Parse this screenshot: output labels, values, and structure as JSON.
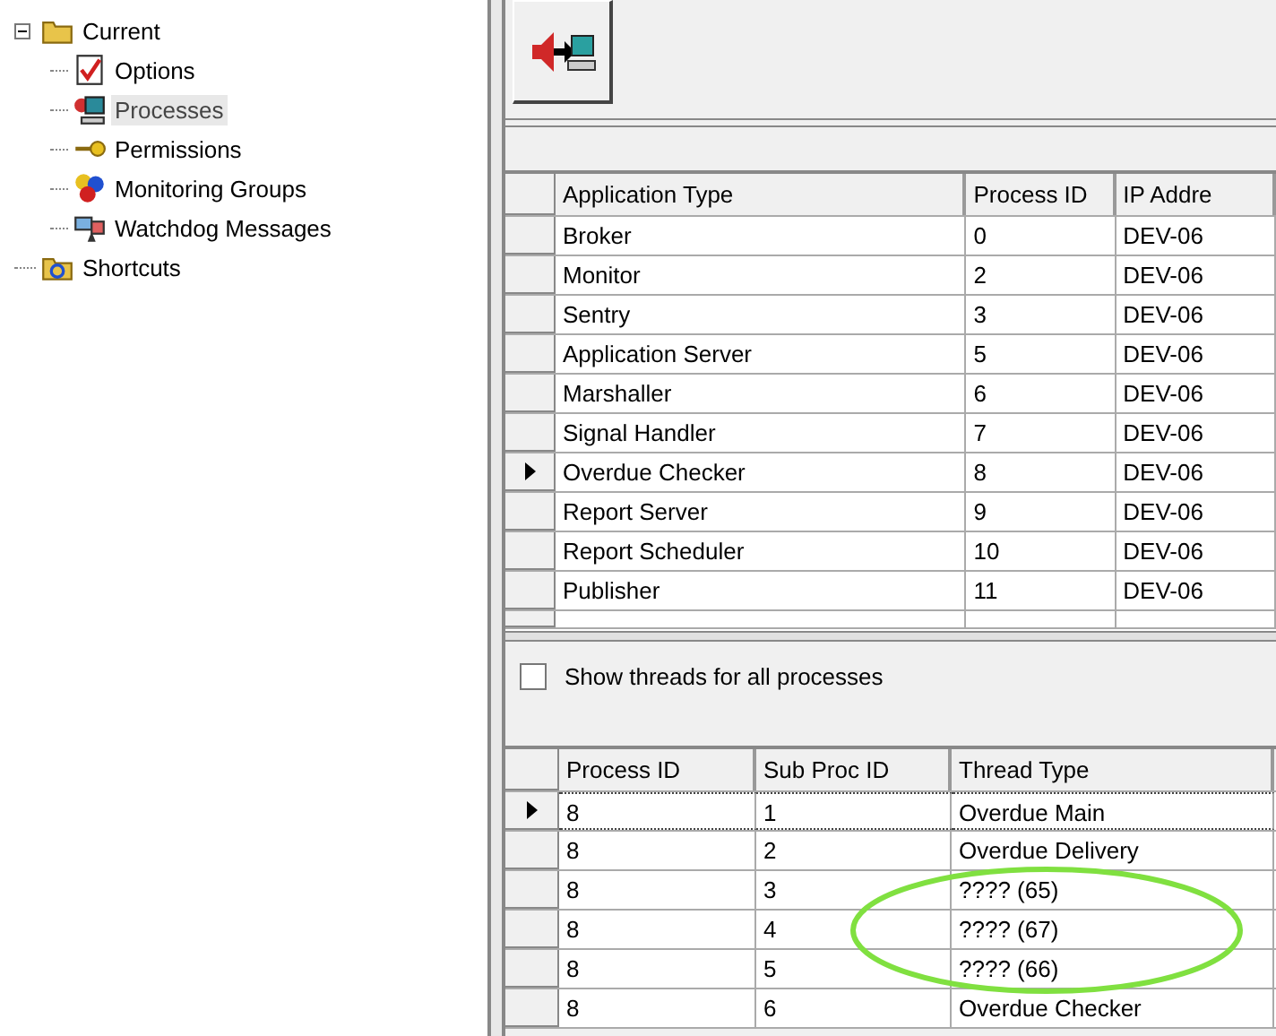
{
  "tree": [
    {
      "label": "Current",
      "expanded": true,
      "selected": false,
      "children": [
        {
          "label": "Options",
          "selected": false
        },
        {
          "label": "Processes",
          "selected": true
        },
        {
          "label": "Permissions",
          "selected": false
        },
        {
          "label": "Monitoring Groups",
          "selected": false
        },
        {
          "label": "Watchdog Messages",
          "selected": false
        }
      ]
    },
    {
      "label": "Shortcuts",
      "selected": false
    }
  ],
  "processes_table": {
    "columns": [
      "Application Type",
      "Process ID",
      "IP Addre"
    ],
    "rows": [
      {
        "cells": [
          "Broker",
          "0",
          "DEV-06"
        ],
        "selected": false
      },
      {
        "cells": [
          "Monitor",
          "2",
          "DEV-06"
        ],
        "selected": false
      },
      {
        "cells": [
          "Sentry",
          "3",
          "DEV-06"
        ],
        "selected": false
      },
      {
        "cells": [
          "Application Server",
          "5",
          "DEV-06"
        ],
        "selected": false
      },
      {
        "cells": [
          "Marshaller",
          "6",
          "DEV-06"
        ],
        "selected": false
      },
      {
        "cells": [
          "Signal Handler",
          "7",
          "DEV-06"
        ],
        "selected": false
      },
      {
        "cells": [
          "Overdue Checker",
          "8",
          "DEV-06"
        ],
        "selected": true
      },
      {
        "cells": [
          "Report Server",
          "9",
          "DEV-06"
        ],
        "selected": false
      },
      {
        "cells": [
          "Report Scheduler",
          "10",
          "DEV-06"
        ],
        "selected": false
      },
      {
        "cells": [
          "Publisher",
          "11",
          "DEV-06"
        ],
        "selected": false
      }
    ]
  },
  "show_threads_checkbox": {
    "label": "Show threads for all processes",
    "checked": false
  },
  "threads_table": {
    "columns": [
      "Process ID",
      "Sub Proc ID",
      "Thread Type"
    ],
    "rows": [
      {
        "cells": [
          "8",
          "1",
          "Overdue Main"
        ],
        "selected": true
      },
      {
        "cells": [
          "8",
          "2",
          "Overdue Delivery"
        ],
        "selected": false
      },
      {
        "cells": [
          "8",
          "3",
          "???? (65)"
        ],
        "selected": false
      },
      {
        "cells": [
          "8",
          "4",
          "???? (67)"
        ],
        "selected": false
      },
      {
        "cells": [
          "8",
          "5",
          "???? (66)"
        ],
        "selected": false
      },
      {
        "cells": [
          "8",
          "6",
          "Overdue Checker"
        ],
        "selected": false
      }
    ]
  }
}
